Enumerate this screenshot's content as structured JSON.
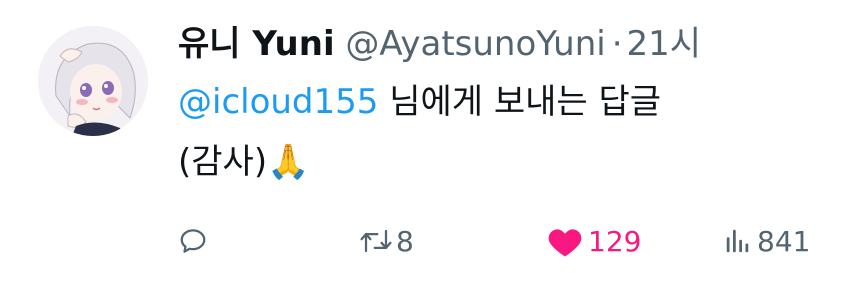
{
  "tweet": {
    "display_name": "유니 Yuni",
    "handle": "@AyatsunoYuni",
    "separator": "·",
    "time": "21시",
    "reply_prefix_mention": "@icloud155",
    "reply_suffix": " 님에게 보내는 답글",
    "body": "(감사)🙏",
    "avatar_icon": "anime-character-avatar"
  },
  "actions": {
    "reply_icon": "reply-bubble-icon",
    "retweet_icon": "retweet-icon",
    "retweet_count": "8",
    "like_icon": "heart-icon",
    "like_count": "129",
    "like_color": "#f91880",
    "views_icon": "views-bar-chart-icon",
    "views_count": "841"
  },
  "colors": {
    "link": "#1d9bf0",
    "secondary_text": "#536471",
    "primary_text": "#0f1419",
    "like_active": "#f91880"
  }
}
